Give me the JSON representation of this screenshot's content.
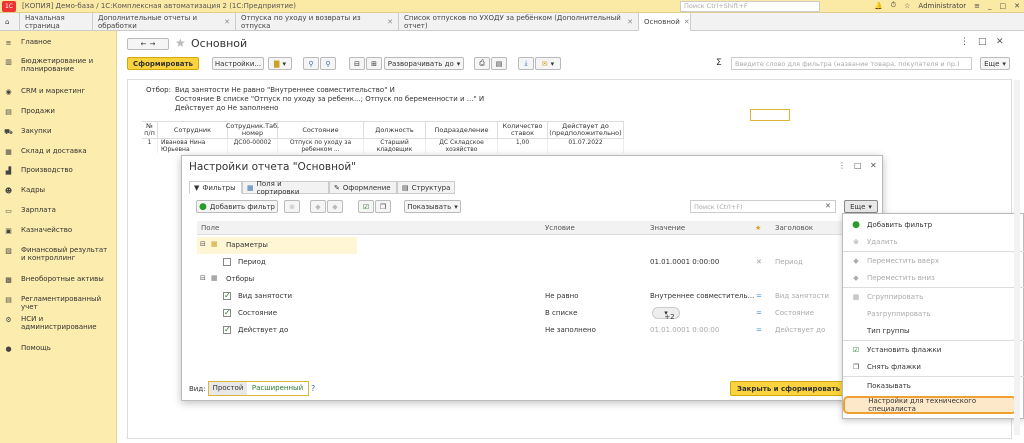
{
  "window": {
    "title": "[КОПИЯ] Демо-база / 1С:Комплексная автоматизация 2  (1С:Предприятие)",
    "search_placeholder": "Поиск Ctrl+Shift+F",
    "user": "Administrator"
  },
  "tabs": [
    {
      "label": "Начальная страница"
    },
    {
      "label": "Дополнительные отчеты и обработки"
    },
    {
      "label": "Отпуска по уходу и возвраты из отпуска"
    },
    {
      "label": "Список отпусков по УХОДУ за ребёнком (Дополнительный отчет)"
    },
    {
      "label": "Основной"
    }
  ],
  "sidebar": {
    "items": [
      {
        "label": "Главное",
        "icon": "menu-icon"
      },
      {
        "label": "Бюджетирование и планирование",
        "icon": "chart-icon"
      },
      {
        "label": "CRM и маркетинг",
        "icon": "crm-icon"
      },
      {
        "label": "Продажи",
        "icon": "sales-icon"
      },
      {
        "label": "Закупки",
        "icon": "cart-icon"
      },
      {
        "label": "Склад и доставка",
        "icon": "warehouse-icon"
      },
      {
        "label": "Производство",
        "icon": "factory-icon"
      },
      {
        "label": "Кадры",
        "icon": "people-icon"
      },
      {
        "label": "Зарплата",
        "icon": "salary-icon"
      },
      {
        "label": "Казначейство",
        "icon": "treasury-icon"
      },
      {
        "label": "Финансовый результат и контроллинг",
        "icon": "finance-icon"
      },
      {
        "label": "Внеоборотные активы",
        "icon": "assets-icon"
      },
      {
        "label": "Регламентированный учет",
        "icon": "accounting-icon"
      },
      {
        "label": "НСИ и администрирование",
        "icon": "settings-icon"
      },
      {
        "label": "Помощь",
        "icon": "help-icon"
      }
    ]
  },
  "report": {
    "title": "Основной",
    "toolbar": {
      "generate": "Сформировать",
      "settings": "Настройки...",
      "expand": "Разворачивать до",
      "search_placeholder": "Введите слово для фильтра (название товара, покупателя и пр.)",
      "more": "Еще"
    },
    "filter_label": "Отбор:",
    "filter_lines": [
      "Вид занятости Не равно \"Внутреннее совместительство\" И",
      "Состояние В списке \"Отпуск по уходу за ребенк...; Отпуск по беременности и ...\" И",
      "Действует до Не заполнено"
    ],
    "columns": [
      "№ п/п",
      "Сотрудник",
      "Сотрудник.Таб. номер",
      "Состояние",
      "Должность",
      "Подразделение",
      "Количество ставок",
      "Действует до (предположительно)"
    ],
    "row": [
      "1",
      "Иванова Нина Юрьевна",
      "ДС00-00002",
      "Отпуск по уходу за ребенком ...",
      "Старший кладовщик",
      "ДС Складское хозяйство",
      "1,00",
      "01.07.2022"
    ]
  },
  "dialog": {
    "title": "Настройки отчета \"Основной\"",
    "tabs": [
      "Фильтры",
      "Поля и сортировки",
      "Оформление",
      "Структура"
    ],
    "add_filter": "Добавить фильтр",
    "show": "Показывать",
    "search_placeholder": "Поиск (Ctrl+F)",
    "more": "Еще",
    "columns": {
      "field": "Поле",
      "condition": "Условие",
      "value": "Значение",
      "title": "Заголовок"
    },
    "rows": [
      {
        "field": "Параметры",
        "condition": "",
        "value": "",
        "title": ""
      },
      {
        "field": "Период",
        "condition": "",
        "value": "01.01.0001 0:00:00",
        "title": "Период"
      },
      {
        "field": "Отборы",
        "condition": "",
        "value": "",
        "title": ""
      },
      {
        "field": "Вид занятости",
        "condition": "Не равно",
        "value": "Внутреннее совместитель...",
        "title": "Вид занятости"
      },
      {
        "field": "Состояние",
        "condition": "В списке",
        "value": "+2",
        "title": "Состояние"
      },
      {
        "field": "Действует до",
        "condition": "Не заполнено",
        "value": "01.01.0001 0:00:00",
        "title": "Действует до"
      }
    ],
    "view_label": "Вид:",
    "view_simple": "Простой",
    "view_extended": "Расширенный",
    "help": "?",
    "close_generate": "Закрыть и сформировать"
  },
  "menu": {
    "items": [
      {
        "label": "Добавить фильтр",
        "icon": "add-icon"
      },
      {
        "label": "Удалить",
        "icon": "delete-icon"
      },
      {
        "label": "Переместить вверх",
        "icon": "up-icon"
      },
      {
        "label": "Переместить вниз",
        "icon": "down-icon"
      },
      {
        "label": "Сгруппировать",
        "icon": "group-icon"
      },
      {
        "label": "Разгруппировать",
        "icon": ""
      },
      {
        "label": "Тип группы",
        "icon": ""
      },
      {
        "label": "Установить флажки",
        "icon": "check-all-icon"
      },
      {
        "label": "Снять флажки",
        "icon": "uncheck-all-icon"
      },
      {
        "label": "Показывать",
        "icon": ""
      },
      {
        "label": "Настройки для технического специалиста",
        "icon": ""
      }
    ]
  },
  "colors": {
    "accent": "#fad33f",
    "sidebar": "#fcecad",
    "highlight": "#f0a030",
    "check": "#2a7a2a"
  }
}
